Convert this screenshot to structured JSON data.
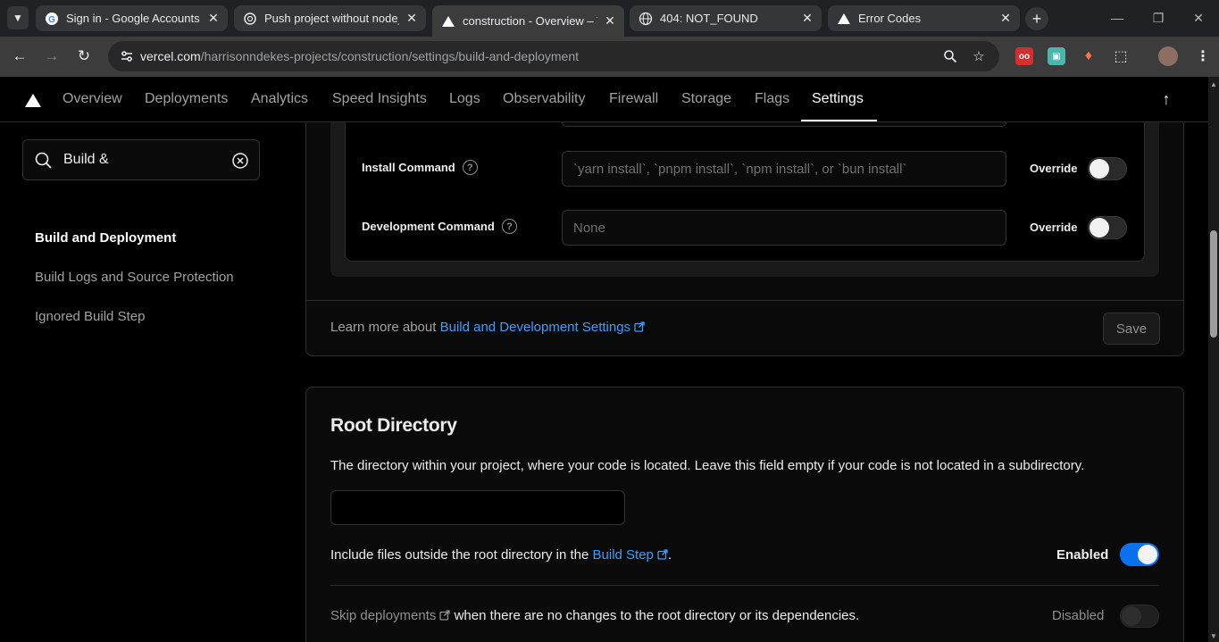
{
  "browser": {
    "tabs": [
      {
        "title": "Sign in - Google Accounts",
        "icon": "google-icon"
      },
      {
        "title": "Push project without node_m",
        "icon": "chatgpt-icon"
      },
      {
        "title": "construction - Overview – Ve",
        "icon": "vercel-icon",
        "active": true
      },
      {
        "title": "404: NOT_FOUND",
        "icon": "globe-icon"
      },
      {
        "title": "Error Codes",
        "icon": "vercel-icon"
      }
    ],
    "url_host": "vercel.com",
    "url_path": "/harrisonndekes-projects/construction/settings/build-and-deployment"
  },
  "nav": {
    "items": [
      "Overview",
      "Deployments",
      "Analytics",
      "Speed Insights",
      "Logs",
      "Observability",
      "Firewall",
      "Storage",
      "Flags",
      "Settings"
    ],
    "active": "Settings"
  },
  "sidebar": {
    "search_value": "Build &",
    "links": [
      "Build and Deployment",
      "Build Logs and Source Protection",
      "Ignored Build Step"
    ],
    "active": "Build and Deployment"
  },
  "build_settings": {
    "install": {
      "label": "Install Command",
      "placeholder": "`yarn install`, `pnpm install`, `npm install`, or `bun install`",
      "override_label": "Override"
    },
    "development": {
      "label": "Development Command",
      "placeholder": "None",
      "override_label": "Override"
    },
    "learn_prefix": "Learn more about",
    "learn_link": "Build and Development Settings",
    "save_label": "Save"
  },
  "root_directory": {
    "title": "Root Directory",
    "description": "The directory within your project, where your code is located. Leave this field empty if your code is not located in a subdirectory.",
    "input_value": "",
    "include_prefix": "Include files outside the root directory in the",
    "include_link": "Build Step",
    "include_suffix": ".",
    "include_state": "Enabled",
    "skip_link": "Skip deployments",
    "skip_text": "when there are no changes to the root directory or its dependencies.",
    "skip_state": "Disabled"
  },
  "colors": {
    "accent": "#0a72ef",
    "link": "#3b9eff",
    "background": "#000000"
  }
}
